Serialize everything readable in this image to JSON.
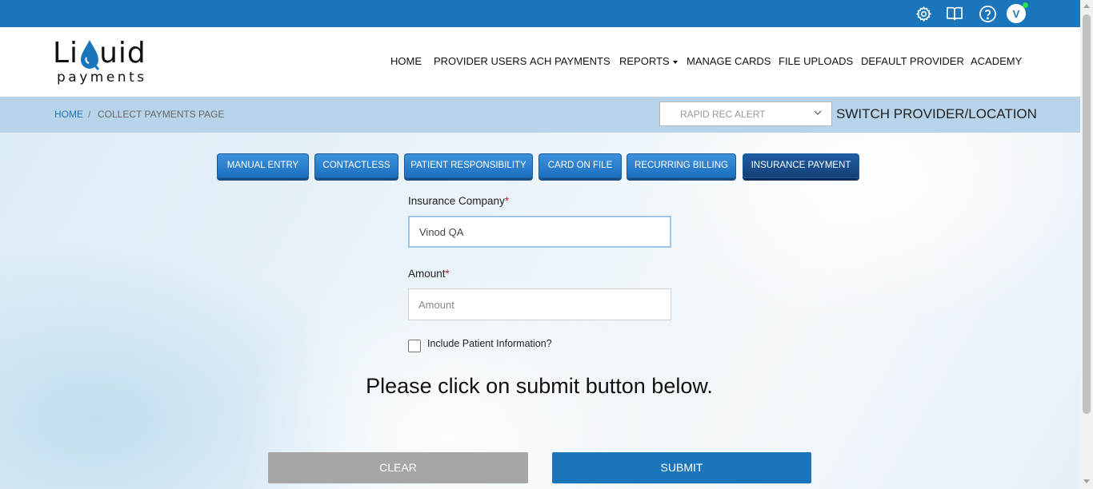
{
  "topbar": {
    "icons": [
      "gear-icon",
      "book-icon",
      "help-icon"
    ],
    "avatar_initial": "V",
    "online_color": "#2ee24a",
    "bar_color": "#1b75bb"
  },
  "logo": {
    "word_left": "Li",
    "word_right": "uid",
    "sub": "payments"
  },
  "nav": {
    "items": [
      "HOME",
      "PROVIDER USERS",
      "ACH PAYMENTS",
      "REPORTS",
      "MANAGE CARDS",
      "FILE UPLOADS",
      "DEFAULT PROVIDER",
      "ACADEMY"
    ]
  },
  "breadcrumb": {
    "home": "HOME",
    "separator": "/",
    "current": "COLLECT PAYMENTS PAGE"
  },
  "provider_select": {
    "value": "RAPID REC ALERT",
    "label": "SWITCH PROVIDER/LOCATION"
  },
  "tabs": [
    {
      "label": "MANUAL ENTRY",
      "active": false
    },
    {
      "label": "CONTACTLESS",
      "active": false
    },
    {
      "label": "PATIENT RESPONSIBILITY",
      "active": false
    },
    {
      "label": "CARD ON FILE",
      "active": false
    },
    {
      "label": "RECURRING BILLING",
      "active": false
    },
    {
      "label": "INSURANCE PAYMENT",
      "active": true
    }
  ],
  "form": {
    "insurance_label": "Insurance Company",
    "insurance_value": "Vinod QA",
    "amount_label": "Amount",
    "amount_placeholder": "Amount",
    "required_mark": "*",
    "include_patient_label": "Include Patient Information?",
    "notice": "Please click on submit button below.",
    "clear_label": "CLEAR",
    "submit_label": "SUBMIT"
  }
}
